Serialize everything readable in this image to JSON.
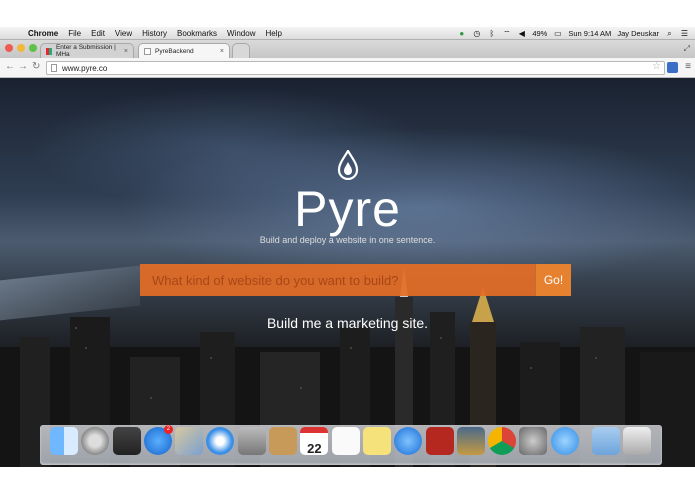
{
  "menubar": {
    "app": "Chrome",
    "items": [
      "File",
      "Edit",
      "View",
      "History",
      "Bookmarks",
      "Window",
      "Help"
    ],
    "battery": "49%",
    "clock": "Sun 9:14 AM",
    "user": "Jay Deuskar"
  },
  "tabs": [
    {
      "title": "Enter a Submission | MHa",
      "active": false
    },
    {
      "title": "PyreBackend",
      "active": true
    }
  ],
  "toolbar": {
    "url": "www.pyre.co"
  },
  "hero": {
    "brand": "Pyre",
    "tagline": "Build and deploy a website in one sentence.",
    "search_placeholder": "What kind of website do you want to build?",
    "go_label": "Go!",
    "example": "Build me a marketing site."
  },
  "dock": {
    "calendar_day": "22",
    "app_store_badge": "2",
    "icons": [
      "finder-icon",
      "launchpad-icon",
      "mission-control-icon",
      "app-store-icon",
      "mail-stamp-icon",
      "safari-icon",
      "facetime-icon",
      "contacts-icon",
      "calendar-icon",
      "reminders-icon",
      "notes-icon",
      "itunes-icon",
      "photo-booth-icon",
      "iphoto-icon",
      "chrome-icon",
      "system-preferences-icon",
      "messages-icon",
      "folder-icon",
      "trash-icon"
    ]
  },
  "colors": {
    "accent": "#e56e26",
    "go": "#e6812f"
  }
}
